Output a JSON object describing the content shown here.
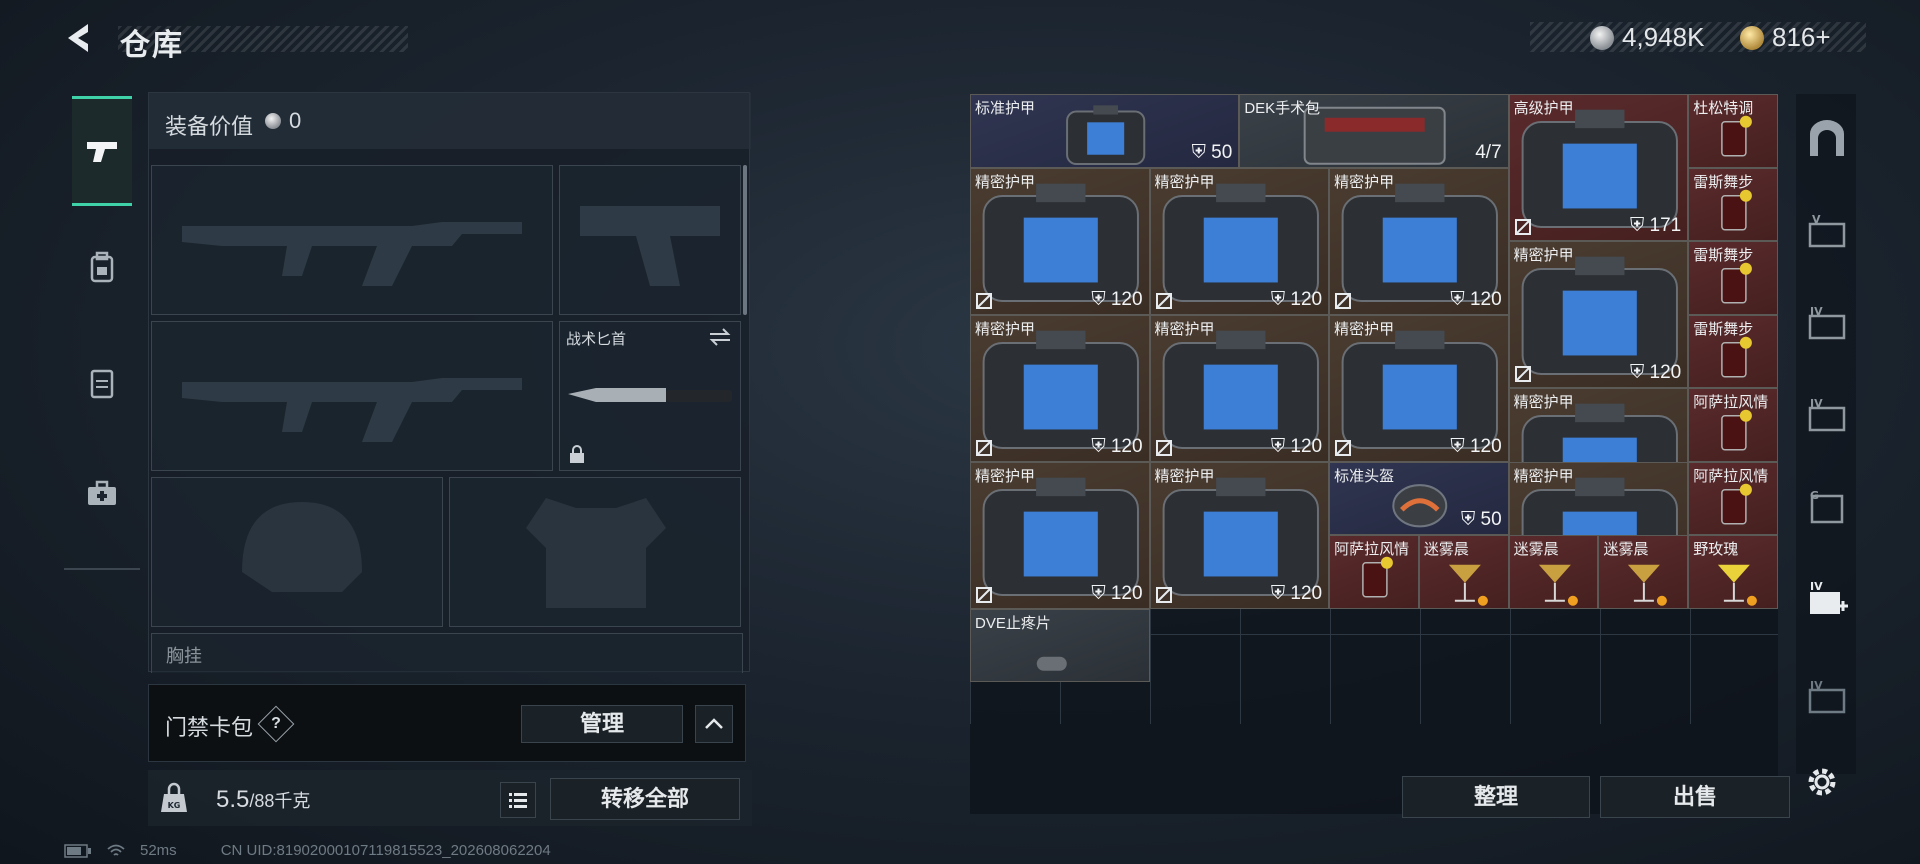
{
  "header": {
    "title": "仓库"
  },
  "currency": {
    "silver": "4,948K",
    "gold": "816+"
  },
  "equipment": {
    "value_label": "装备价值",
    "value": "0",
    "knife_name": "战术匕首",
    "chest_label": "胸挂"
  },
  "keycard": {
    "label": "门禁卡包",
    "help": "?",
    "manage": "管理"
  },
  "weight": {
    "current": "5.5",
    "capacity": "/88千克",
    "icon_label": "KG",
    "transfer_all": "转移全部"
  },
  "status": {
    "ping": "52ms",
    "uid": "CN UID:8190200010711981552​3_202608062204"
  },
  "stash": {
    "items": [
      {
        "name": "标准护甲",
        "dur": "50",
        "bg": "blue",
        "kind": "armor",
        "nr": false
      },
      {
        "name": "DEK手术包",
        "dur": "4/7",
        "bg": "gray",
        "kind": "kit",
        "nr": false
      },
      {
        "name": "高级护甲",
        "dur": "171",
        "bg": "red",
        "kind": "armor",
        "nr": true
      },
      {
        "name": "杜松特调",
        "dur": "",
        "bg": "red",
        "kind": "drink",
        "nr": false
      },
      {
        "name": "精密护甲",
        "dur": "120",
        "bg": "brown",
        "kind": "armor",
        "nr": true
      },
      {
        "name": "精密护甲",
        "dur": "120",
        "bg": "brown",
        "kind": "armor",
        "nr": true
      },
      {
        "name": "精密护甲",
        "dur": "120",
        "bg": "brown",
        "kind": "armor",
        "nr": true
      },
      {
        "name": "雷斯舞步",
        "dur": "",
        "bg": "red",
        "kind": "drink",
        "nr": false
      },
      {
        "name": "精密护甲",
        "dur": "120",
        "bg": "brown",
        "kind": "armor",
        "nr": true
      },
      {
        "name": "雷斯舞步",
        "dur": "",
        "bg": "red",
        "kind": "drink",
        "nr": false
      },
      {
        "name": "精密护甲",
        "dur": "120",
        "bg": "brown",
        "kind": "armor",
        "nr": true
      },
      {
        "name": "精密护甲",
        "dur": "120",
        "bg": "brown",
        "kind": "armor",
        "nr": true
      },
      {
        "name": "精密护甲",
        "dur": "120",
        "bg": "brown",
        "kind": "armor",
        "nr": true
      },
      {
        "name": "雷斯舞步",
        "dur": "",
        "bg": "red",
        "kind": "drink",
        "nr": false
      },
      {
        "name": "精密护甲",
        "dur": "120",
        "bg": "brown",
        "kind": "armor",
        "nr": true
      },
      {
        "name": "阿萨拉风情",
        "dur": "",
        "bg": "red",
        "kind": "drink",
        "nr": false
      },
      {
        "name": "精密护甲",
        "dur": "120",
        "bg": "brown",
        "kind": "armor",
        "nr": true
      },
      {
        "name": "精密护甲",
        "dur": "120",
        "bg": "brown",
        "kind": "armor",
        "nr": true
      },
      {
        "name": "标准头盔",
        "dur": "50",
        "bg": "blue",
        "kind": "helmet",
        "nr": false
      },
      {
        "name": "精密护甲",
        "dur": "120",
        "bg": "brown",
        "kind": "armor",
        "nr": true
      },
      {
        "name": "阿萨拉风情",
        "dur": "",
        "bg": "red",
        "kind": "drink",
        "nr": false
      },
      {
        "name": "阿萨拉风情",
        "dur": "",
        "bg": "red",
        "kind": "drink",
        "nr": false
      },
      {
        "name": "迷雾晨",
        "dur": "",
        "bg": "red",
        "kind": "cocktail",
        "nr": false
      },
      {
        "name": "迷雾晨",
        "dur": "",
        "bg": "red",
        "kind": "cocktail",
        "nr": false
      },
      {
        "name": "迷雾晨",
        "dur": "",
        "bg": "red",
        "kind": "cocktail",
        "nr": false
      },
      {
        "name": "野玫瑰",
        "dur": "",
        "bg": "red",
        "kind": "lemon",
        "nr": false
      },
      {
        "name": "DVE止疼片",
        "dur": "",
        "bg": "gray",
        "kind": "pill",
        "nr": false
      }
    ],
    "sort": "整理",
    "sell": "出售"
  },
  "right_rail": {
    "labels": [
      "",
      "V",
      "IV",
      "IV",
      "G",
      "IV",
      "IV"
    ]
  },
  "colors": {
    "accent": "#3fd1a7",
    "brown": "#4a3c30",
    "red": "#5a2a2c",
    "blue": "#303551"
  }
}
